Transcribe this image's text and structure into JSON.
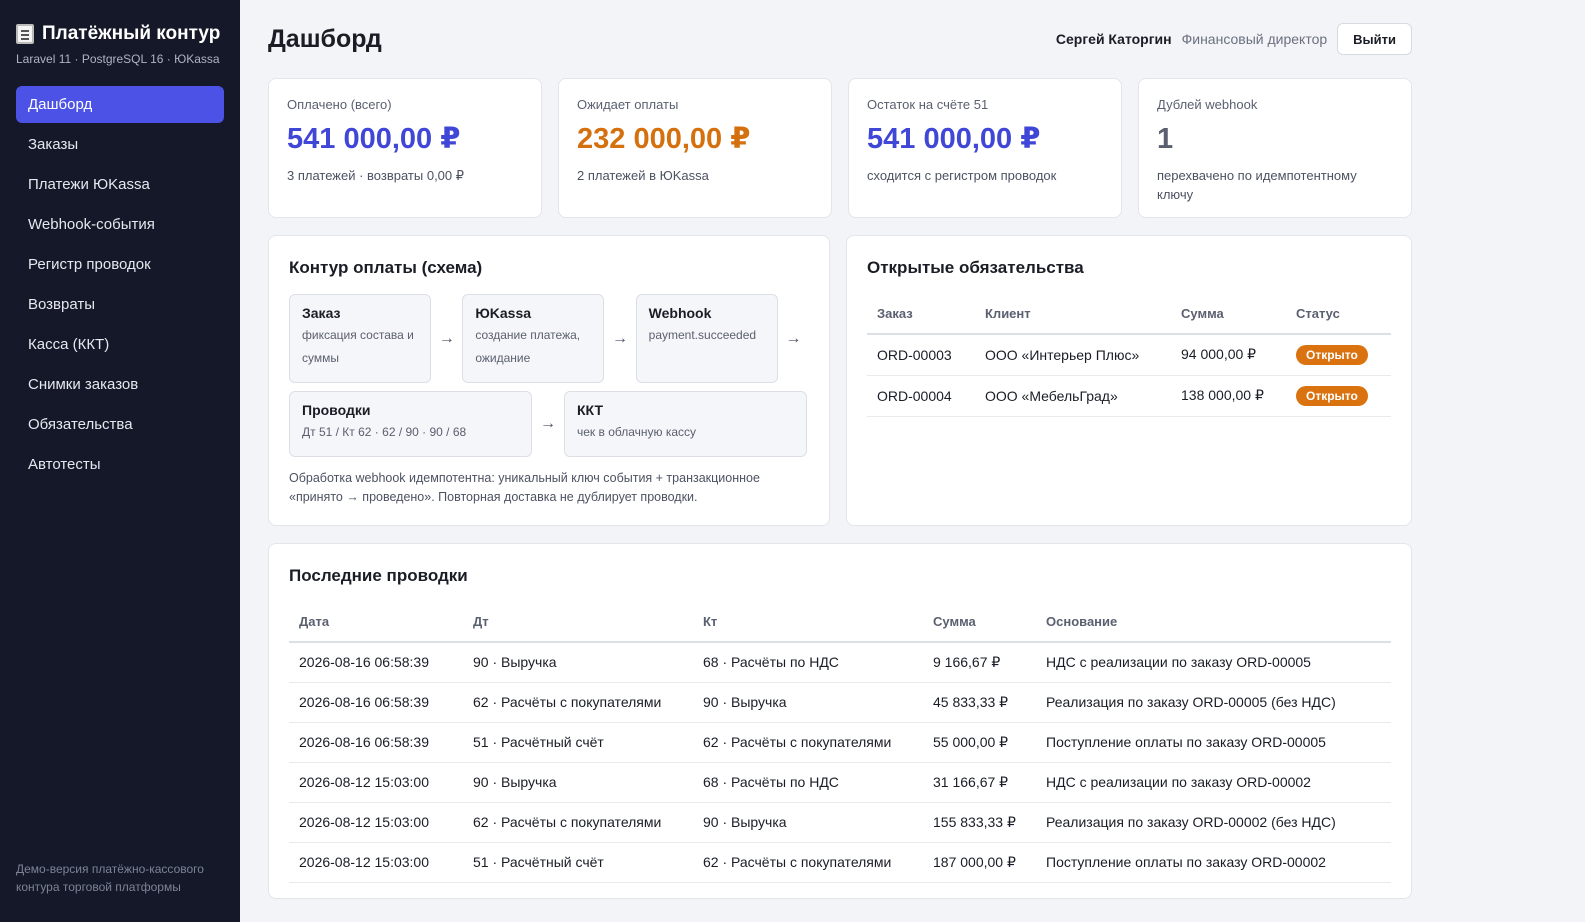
{
  "brand": {
    "title": "Платёжный контур",
    "subtitle": "Laravel 11 · PostgreSQL 16 · ЮKassa",
    "icon": "receipt-icon"
  },
  "nav": [
    {
      "label": "Дашборд",
      "active": true
    },
    {
      "label": "Заказы"
    },
    {
      "label": "Платежи ЮKassa"
    },
    {
      "label": "Webhook-события"
    },
    {
      "label": "Регистр проводок"
    },
    {
      "label": "Возвраты"
    },
    {
      "label": "Касса (ККТ)"
    },
    {
      "label": "Снимки заказов"
    },
    {
      "label": "Обязательства"
    },
    {
      "label": "Автотесты"
    }
  ],
  "sidebar_footer": "Демо-версия платёжно-кассового контура торговой платформы",
  "header": {
    "title": "Дашборд",
    "user_name": "Сергей Каторгин",
    "user_role": "Финансовый директор",
    "logout_label": "Выйти"
  },
  "kpis": [
    {
      "label": "Оплачено (всего)",
      "value": "541 000,00 ₽",
      "note": "3 платежей · возвраты 0,00 ₽",
      "color": "#4046d6"
    },
    {
      "label": "Ожидает оплаты",
      "value": "232 000,00 ₽",
      "note": "2 платежей в ЮKassa",
      "color": "#d4700e"
    },
    {
      "label": "Остаток на счёте 51",
      "value": "541 000,00 ₽",
      "note": "сходится с регистром проводок",
      "color": "#4046d6"
    },
    {
      "label": "Дублей webhook",
      "value": "1",
      "note": "перехвачено по идемпотентному ключу",
      "color": "#5b6070"
    }
  ],
  "scheme": {
    "title": "Контур оплаты (схема)",
    "nodes": [
      {
        "title": "Заказ",
        "desc": "фиксация состава и суммы"
      },
      {
        "title": "ЮKassa",
        "desc": "создание платежа, ожидание"
      },
      {
        "title": "Webhook",
        "desc": "payment.succeeded"
      },
      {
        "title": "Проводки",
        "desc": "Дт 51 / Кт 62 · 62 / 90 · 90 / 68"
      },
      {
        "title": "ККТ",
        "desc": "чек в облачную кассу"
      }
    ],
    "arrow": "→",
    "note": "Обработка webhook идемпотентна: уникальный ключ события + транзакционное «принято → проведено». Повторная доставка не дублирует проводки."
  },
  "liabilities": {
    "title": "Открытые обязательства",
    "headers": [
      "Заказ",
      "Клиент",
      "Сумма",
      "Статус"
    ],
    "rows": [
      {
        "order": "ORD-00003",
        "client": "ООО «Интерьер Плюс»",
        "sum": "94 000,00 ₽",
        "status": "Открыто"
      },
      {
        "order": "ORD-00004",
        "client": "ООО «МебельГрад»",
        "sum": "138 000,00 ₽",
        "status": "Открыто"
      }
    ],
    "status_color": "#d9720f"
  },
  "entries": {
    "title": "Последние проводки",
    "headers": [
      "Дата",
      "Дт",
      "Кт",
      "Сумма",
      "Основание"
    ],
    "rows": [
      {
        "date": "2026-08-16 06:58:39",
        "dt": "90 · Выручка",
        "kt": "68 · Расчёты по НДС",
        "sum": "9 166,67 ₽",
        "basis": "НДС с реализации по заказу ORD-00005"
      },
      {
        "date": "2026-08-16 06:58:39",
        "dt": "62 · Расчёты с покупателями",
        "kt": "90 · Выручка",
        "sum": "45 833,33 ₽",
        "basis": "Реализация по заказу ORD-00005 (без НДС)"
      },
      {
        "date": "2026-08-16 06:58:39",
        "dt": "51 · Расчётный счёт",
        "kt": "62 · Расчёты с покупателями",
        "sum": "55 000,00 ₽",
        "basis": "Поступление оплаты по заказу ORD-00005"
      },
      {
        "date": "2026-08-12 15:03:00",
        "dt": "90 · Выручка",
        "kt": "68 · Расчёты по НДС",
        "sum": "31 166,67 ₽",
        "basis": "НДС с реализации по заказу ORD-00002"
      },
      {
        "date": "2026-08-12 15:03:00",
        "dt": "62 · Расчёты с покупателями",
        "kt": "90 · Выручка",
        "sum": "155 833,33 ₽",
        "basis": "Реализация по заказу ORD-00002 (без НДС)"
      },
      {
        "date": "2026-08-12 15:03:00",
        "dt": "51 · Расчётный счёт",
        "kt": "62 · Расчёты с покупателями",
        "sum": "187 000,00 ₽",
        "basis": "Поступление оплаты по заказу ORD-00002"
      }
    ]
  }
}
